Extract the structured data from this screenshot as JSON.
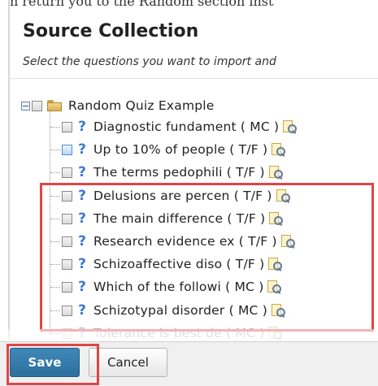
{
  "intro_fragment": "n return you to the Random section inst",
  "heading": "Source Collection",
  "instructions": "Select the questions you want to import and",
  "tree": {
    "root": {
      "label": "Random Quiz Example",
      "expander": "−"
    },
    "questions": [
      {
        "label": "Diagnostic fundament ( MC )",
        "checked_highlight": false
      },
      {
        "label": "Up to 10% of people ( T/F )",
        "checked_highlight": true
      },
      {
        "label": "The terms pedophili ( T/F )",
        "checked_highlight": false
      },
      {
        "label": "Delusions are percen ( T/F )",
        "checked_highlight": false
      },
      {
        "label": "The main difference ( T/F )",
        "checked_highlight": false
      },
      {
        "label": "Research evidence ex ( T/F )",
        "checked_highlight": false
      },
      {
        "label": "Schizoaffective diso ( T/F )",
        "checked_highlight": false
      },
      {
        "label": "Which of the followi ( MC )",
        "checked_highlight": false
      },
      {
        "label": "Schizotypal disorder ( MC )",
        "checked_highlight": false
      },
      {
        "label": "Tolerance is best de ( MC )",
        "checked_highlight": false
      }
    ]
  },
  "buttons": {
    "save": "Save",
    "cancel": "Cancel"
  },
  "colors": {
    "save_bg": "#3478a8",
    "callout_red": "#e04545",
    "question_icon": "#3a78d6"
  },
  "icons": {
    "question": "help-icon",
    "preview": "preview-magnifier-icon",
    "folder": "folder-icon"
  }
}
